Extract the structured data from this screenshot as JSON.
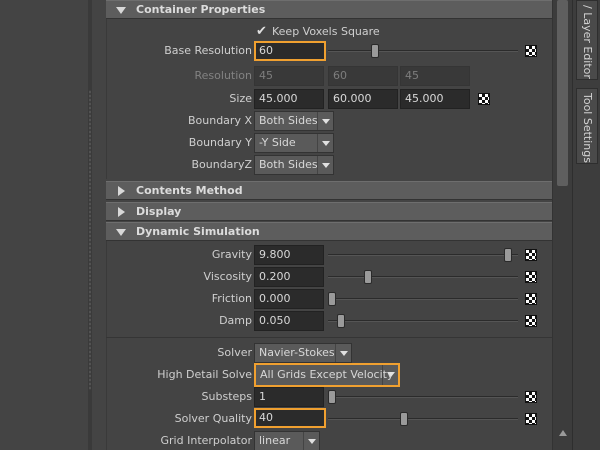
{
  "sections": {
    "container_properties": "Container Properties",
    "contents_method": "Contents Method",
    "display": "Display",
    "dynamic_simulation": "Dynamic Simulation"
  },
  "container": {
    "keep_voxels_square": "Keep Voxels Square",
    "base_resolution_label": "Base Resolution",
    "base_resolution_value": "60",
    "base_resolution_slider": 0.24,
    "resolution_label": "Resolution",
    "resolution_values": [
      "45",
      "60",
      "45"
    ],
    "size_label": "Size",
    "size_values": [
      "45.000",
      "60.000",
      "45.000"
    ],
    "boundary_x_label": "Boundary X",
    "boundary_x_value": "Both Sides",
    "boundary_y_label": "Boundary Y",
    "boundary_y_value": "-Y Side",
    "boundary_z_label": "BoundaryZ",
    "boundary_z_value": "Both Sides"
  },
  "dynamic": {
    "gravity_label": "Gravity",
    "gravity_value": "9.800",
    "gravity_slider": 0.98,
    "viscosity_label": "Viscosity",
    "viscosity_value": "0.200",
    "viscosity_slider": 0.2,
    "friction_label": "Friction",
    "friction_value": "0.000",
    "friction_slider": 0.0,
    "damp_label": "Damp",
    "damp_value": "0.050",
    "damp_slider": 0.05,
    "solver_label": "Solver",
    "solver_value": "Navier-Stokes",
    "high_detail_label": "High Detail Solve",
    "high_detail_value": "All Grids Except Velocity",
    "substeps_label": "Substeps",
    "substeps_value": "1",
    "substeps_slider": 0.0,
    "solver_quality_label": "Solver Quality",
    "solver_quality_value": "40",
    "solver_quality_slider": 0.4,
    "grid_interp_label": "Grid Interpolator",
    "grid_interp_value": "linear"
  },
  "right_tabs": {
    "layer_editor": "/ Layer Editor",
    "tool_settings": "Tool Settings"
  },
  "colors": {
    "highlight": "#f0a030",
    "panel_bg": "#444444",
    "header_bg": "#5d5d5d"
  },
  "icons": {
    "map_button": "checker-map-icon",
    "expand": "triangle-right-icon",
    "collapse": "triangle-down-icon"
  }
}
